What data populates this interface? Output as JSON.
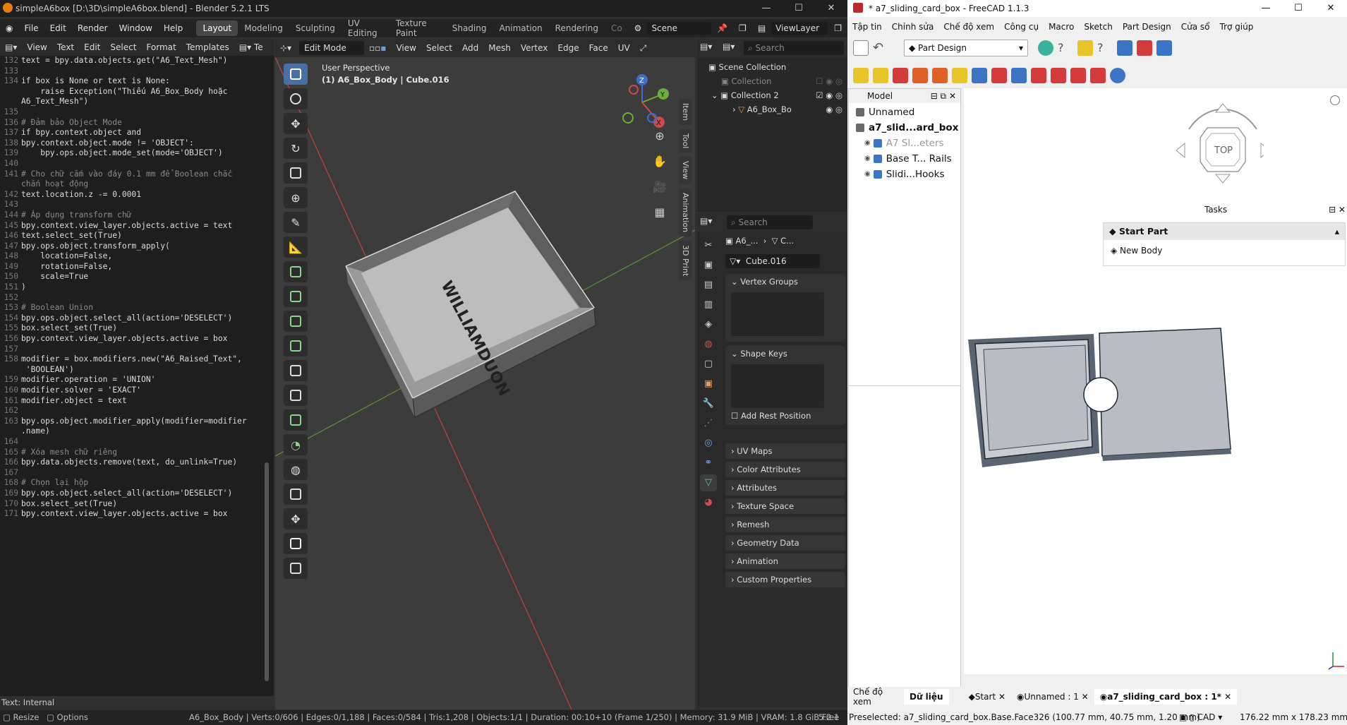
{
  "blender": {
    "title": "simpleA6box [D:\\3D\\simpleA6box.blend] - Blender 5.2.1 LTS",
    "menus": [
      "File",
      "Edit",
      "Render",
      "Window",
      "Help"
    ],
    "workspaces": [
      "Layout",
      "Modeling",
      "Sculpting",
      "UV Editing",
      "Texture Paint",
      "Shading",
      "Animation",
      "Rendering",
      "Co"
    ],
    "scene": "Scene",
    "view_layer": "ViewLayer",
    "text_editor": {
      "menus": [
        "View",
        "Text",
        "Edit",
        "Select",
        "Format",
        "Templates"
      ],
      "status": "Text: Internal",
      "lines": [
        {
          "n": "132",
          "t": "text = bpy.data.objects.get(\"A6_Text_Mesh\")",
          "k": ""
        },
        {
          "n": "133",
          "t": "",
          "k": ""
        },
        {
          "n": "134",
          "t": "if box is None or text is None:",
          "k": ""
        },
        {
          "n": "",
          "t": "    raise Exception(\"Thiếu A6_Box_Body hoặc",
          "k": ""
        },
        {
          "n": "",
          "t": "A6_Text_Mesh\")",
          "k": ""
        },
        {
          "n": "135",
          "t": "",
          "k": ""
        },
        {
          "n": "136",
          "t": "# Đảm bảo Object Mode",
          "k": "cm"
        },
        {
          "n": "137",
          "t": "if bpy.context.object and",
          "k": ""
        },
        {
          "n": "138",
          "t": "bpy.context.object.mode != 'OBJECT':",
          "k": ""
        },
        {
          "n": "139",
          "t": "    bpy.ops.object.mode_set(mode='OBJECT')",
          "k": ""
        },
        {
          "n": "140",
          "t": "",
          "k": ""
        },
        {
          "n": "141",
          "t": "# Cho chữ cắm vào đáy 0.1 mm để Boolean chắc",
          "k": "cm"
        },
        {
          "n": "",
          "t": "chắn hoạt động",
          "k": "cm"
        },
        {
          "n": "142",
          "t": "text.location.z -= 0.0001",
          "k": ""
        },
        {
          "n": "143",
          "t": "",
          "k": ""
        },
        {
          "n": "144",
          "t": "# Áp dụng transform chữ",
          "k": "cm"
        },
        {
          "n": "145",
          "t": "bpy.context.view_layer.objects.active = text",
          "k": ""
        },
        {
          "n": "146",
          "t": "text.select_set(True)",
          "k": ""
        },
        {
          "n": "147",
          "t": "bpy.ops.object.transform_apply(",
          "k": ""
        },
        {
          "n": "148",
          "t": "    location=False,",
          "k": ""
        },
        {
          "n": "149",
          "t": "    rotation=False,",
          "k": ""
        },
        {
          "n": "150",
          "t": "    scale=True",
          "k": ""
        },
        {
          "n": "151",
          "t": ")",
          "k": ""
        },
        {
          "n": "152",
          "t": "",
          "k": ""
        },
        {
          "n": "153",
          "t": "# Boolean Union",
          "k": "cm"
        },
        {
          "n": "154",
          "t": "bpy.ops.object.select_all(action='DESELECT')",
          "k": ""
        },
        {
          "n": "155",
          "t": "box.select_set(True)",
          "k": ""
        },
        {
          "n": "156",
          "t": "bpy.context.view_layer.objects.active = box",
          "k": ""
        },
        {
          "n": "157",
          "t": "",
          "k": ""
        },
        {
          "n": "158",
          "t": "modifier = box.modifiers.new(\"A6_Raised_Text\",",
          "k": ""
        },
        {
          "n": "",
          "t": " 'BOOLEAN')",
          "k": ""
        },
        {
          "n": "159",
          "t": "modifier.operation = 'UNION'",
          "k": ""
        },
        {
          "n": "160",
          "t": "modifier.solver = 'EXACT'",
          "k": ""
        },
        {
          "n": "161",
          "t": "modifier.object = text",
          "k": ""
        },
        {
          "n": "162",
          "t": "",
          "k": ""
        },
        {
          "n": "163",
          "t": "bpy.ops.object.modifier_apply(modifier=modifier",
          "k": ""
        },
        {
          "n": "",
          "t": ".name)",
          "k": ""
        },
        {
          "n": "164",
          "t": "",
          "k": ""
        },
        {
          "n": "165",
          "t": "# Xóa mesh chữ riêng",
          "k": "cm"
        },
        {
          "n": "166",
          "t": "bpy.data.objects.remove(text, do_unlink=True)",
          "k": ""
        },
        {
          "n": "167",
          "t": "",
          "k": ""
        },
        {
          "n": "168",
          "t": "# Chọn lại hộp",
          "k": "cm"
        },
        {
          "n": "169",
          "t": "bpy.ops.object.select_all(action='DESELECT')",
          "k": ""
        },
        {
          "n": "170",
          "t": "box.select_set(True)",
          "k": ""
        },
        {
          "n": "171",
          "t": "bpy.context.view_layer.objects.active = box",
          "k": ""
        }
      ]
    },
    "viewport": {
      "mode": "Edit Mode",
      "menus": [
        "View",
        "Select",
        "Add",
        "Mesh",
        "Vertex",
        "Edge",
        "Face",
        "UV"
      ],
      "info_line1": "User Perspective",
      "info_line2": "(1) A6_Box_Body | Cube.016",
      "engraved_text": "WILLIAMDUON",
      "side_tabs": [
        "Item",
        "Tool",
        "View",
        "Animation",
        "3D Print"
      ]
    },
    "outliner": {
      "search_placeholder": "Search",
      "rows": [
        "Scene Collection",
        "Collection",
        "Collection 2",
        "A6_Box_Bo"
      ]
    },
    "properties": {
      "search_placeholder": "Search",
      "breadcrumb_a": "A6_...",
      "breadcrumb_b": "C...",
      "mesh_name": "Cube.016",
      "vertex_groups": "Vertex Groups",
      "shape_keys": "Shape Keys",
      "add_rest": "Add Rest Position",
      "collapsed": [
        "UV Maps",
        "Color Attributes",
        "Attributes",
        "Texture Space",
        "Remesh",
        "Geometry Data",
        "Animation",
        "Custom Properties"
      ]
    },
    "status": {
      "left_a": "Resize",
      "left_b": "Options",
      "info": "A6_Box_Body | Verts:0/606 | Edges:0/1,188 | Faces:0/584 | Tris:1,208 | Objects:1/1 | Duration: 00:10+10 (Frame 1/250) | Memory: 31.9 MiB | VRAM: 1.8 GiB Free",
      "version": "5.2.1"
    }
  },
  "freecad": {
    "title": "* a7_sliding_card_box - FreeCAD 1.1.3",
    "menus": [
      "Tập tin",
      "Chỉnh sửa",
      "Chế độ xem",
      "Công cụ",
      "Macro",
      "Sketch",
      "Part Design",
      "Cửa sổ",
      "Trợ giúp"
    ],
    "workbench": "Part Design",
    "model_tab": "Model",
    "tree": [
      {
        "label": "Unnamed",
        "bold": false,
        "indent": 0
      },
      {
        "label": "a7_slid...ard_box",
        "bold": true,
        "indent": 0
      },
      {
        "label": "A7 Sl...eters",
        "bold": false,
        "indent": 1,
        "grey": true
      },
      {
        "label": "Base T... Rails",
        "bold": false,
        "indent": 1
      },
      {
        "label": "Slidi...Hooks",
        "bold": false,
        "indent": 1
      }
    ],
    "tasks_title": "Tasks",
    "start_part": "Start Part",
    "new_body": "New Body",
    "navcube": "TOP",
    "bottom_tabs": [
      "Chế độ xem",
      "Dữ liệu"
    ],
    "doc_tabs": [
      "Start",
      "Unnamed : 1",
      "a7_sliding_card_box : 1*"
    ],
    "status": "Preselected: a7_sliding_card_box.Base.Face326 (100.77 mm, 40.75 mm, 1.20 mm)",
    "cad": "CAD",
    "dims": "176.22 mm x 178.23 mm"
  }
}
